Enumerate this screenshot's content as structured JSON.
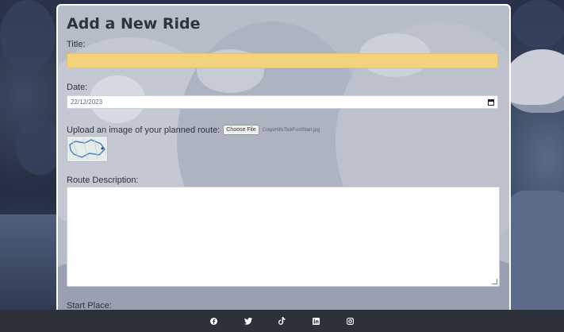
{
  "form": {
    "title": "Add a New Ride",
    "title_label": "Title:",
    "title_value": "",
    "date_label": "Date:",
    "date_value": "22/12/2023",
    "upload_label": "Upload an image of your planned route:",
    "choose_file_label": "Choose File",
    "file_name": "CraysHillsTickFordStart.jpg",
    "route_description_label": "Route Description:",
    "route_description_value": "",
    "start_place_label": "Start Place:"
  },
  "footer": {
    "icons": [
      "facebook-icon",
      "twitter-icon",
      "tiktok-icon",
      "linkedin-icon",
      "instagram-icon"
    ]
  },
  "colors": {
    "title_field_bg": "#f2d27a",
    "footer_bg": "#2d3139",
    "card_border": "#ffffff"
  }
}
